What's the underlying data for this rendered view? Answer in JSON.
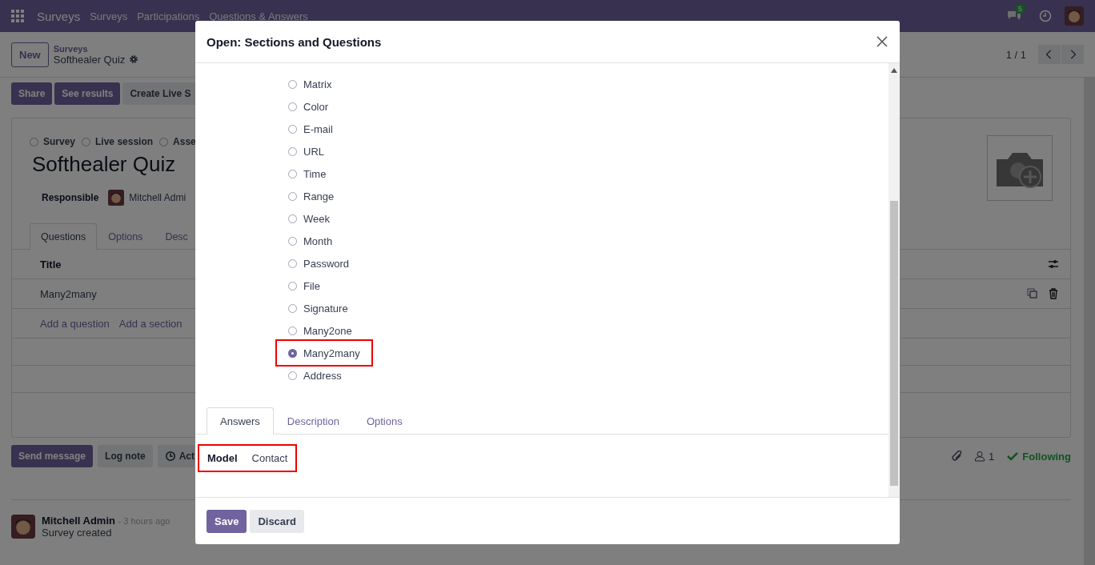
{
  "navbar": {
    "app": "Surveys",
    "menu": [
      "Surveys",
      "Participations",
      "Questions & Answers"
    ],
    "chat_badge": "5"
  },
  "control_panel": {
    "new_button": "New",
    "breadcrumb_parent": "Surveys",
    "breadcrumb_current": "Softhealer Quiz",
    "pager": "1 / 1"
  },
  "action_buttons": [
    {
      "label": "Share",
      "kind": "primary"
    },
    {
      "label": "See results",
      "kind": "primary"
    },
    {
      "label": "Create Live S",
      "kind": "secondary"
    }
  ],
  "form": {
    "survey_types": [
      {
        "label": "Survey",
        "selected": false
      },
      {
        "label": "Live session",
        "selected": false
      },
      {
        "label": "Asse",
        "selected": false
      }
    ],
    "title": "Softhealer Quiz",
    "responsible_label": "Responsible",
    "responsible": "Mitchell Admi",
    "tabs": [
      {
        "label": "Questions",
        "selected": true
      },
      {
        "label": "Options",
        "selected": false
      },
      {
        "label": "Desc",
        "selected": false
      }
    ],
    "table": {
      "columns": [
        "Title"
      ],
      "rows": [
        [
          "Many2many"
        ]
      ],
      "add_links": [
        "Add a question",
        "Add a section"
      ]
    }
  },
  "chatter": {
    "buttons": [
      {
        "label": "Send message",
        "kind": "primary"
      },
      {
        "label": "Log note",
        "kind": "secondary"
      },
      {
        "label": "Act",
        "kind": "activity"
      }
    ],
    "followers": "1",
    "following": "Following",
    "messages": [
      {
        "author": "Mitchell Admin",
        "time": "- 3 hours ago",
        "body": "Survey created"
      }
    ]
  },
  "dialog": {
    "title": "Open: Sections and Questions",
    "options": [
      {
        "label": "Matrix",
        "selected": false,
        "highlighted": false
      },
      {
        "label": "Color",
        "selected": false,
        "highlighted": false
      },
      {
        "label": "E-mail",
        "selected": false,
        "highlighted": false
      },
      {
        "label": "URL",
        "selected": false,
        "highlighted": false
      },
      {
        "label": "Time",
        "selected": false,
        "highlighted": false
      },
      {
        "label": "Range",
        "selected": false,
        "highlighted": false
      },
      {
        "label": "Week",
        "selected": false,
        "highlighted": false
      },
      {
        "label": "Month",
        "selected": false,
        "highlighted": false
      },
      {
        "label": "Password",
        "selected": false,
        "highlighted": false
      },
      {
        "label": "File",
        "selected": false,
        "highlighted": false
      },
      {
        "label": "Signature",
        "selected": false,
        "highlighted": false
      },
      {
        "label": "Many2one",
        "selected": false,
        "highlighted": false
      },
      {
        "label": "Many2many",
        "selected": true,
        "highlighted": true
      },
      {
        "label": "Address",
        "selected": false,
        "highlighted": false
      }
    ],
    "tabs": [
      {
        "label": "Answers",
        "selected": true
      },
      {
        "label": "Description",
        "selected": false
      },
      {
        "label": "Options",
        "selected": false
      }
    ],
    "field": {
      "label": "Model",
      "value": "Contact",
      "highlighted": true
    },
    "buttons": [
      {
        "label": "Save",
        "kind": "primary"
      },
      {
        "label": "Discard",
        "kind": "secondary"
      }
    ]
  }
}
